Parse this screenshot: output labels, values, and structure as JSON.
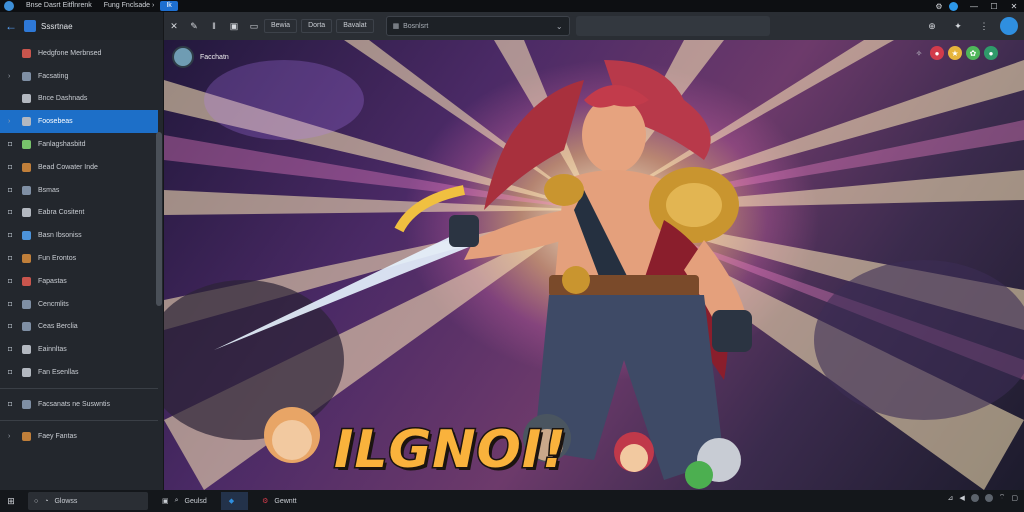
{
  "titlebar": {
    "tabs": [
      "Bnse Dasrt Eitflnrenk",
      "Fung Fnclsade ›",
      "Ik"
    ],
    "buttons": [
      "minimize-icon",
      "maximize-icon",
      "close-icon"
    ]
  },
  "sidebar": {
    "back_label": "←",
    "title": "Sssrtnae",
    "items": [
      {
        "label": "Hedgfone Merbnsed",
        "chevron": ""
      },
      {
        "label": "Facsating",
        "chevron": "›"
      },
      {
        "label": "Bnce Dashnads",
        "chevron": ""
      },
      {
        "label": "Foosebeas",
        "chevron": "›",
        "selected": true
      },
      {
        "label": "Fanlagshasbitd",
        "chevron": ""
      },
      {
        "label": "Bead Cowater Inde",
        "chevron": ""
      },
      {
        "label": "Bsmas",
        "chevron": ""
      },
      {
        "label": "Eabra Cositent",
        "chevron": ""
      },
      {
        "label": "Basn Ibsoniss",
        "chevron": ""
      },
      {
        "label": "Fun Erontos",
        "chevron": ""
      },
      {
        "label": "Fapastas",
        "chevron": ""
      },
      {
        "label": "Cencmlits",
        "chevron": ""
      },
      {
        "label": "Ceas Berclia",
        "chevron": ""
      },
      {
        "label": "Eainnltas",
        "chevron": ""
      },
      {
        "label": "Fan Esenllas",
        "chevron": ""
      },
      {
        "label": "Facsanats ne Suswntis",
        "chevron": ""
      },
      {
        "label": "Faey Fantas",
        "chevron": ""
      }
    ]
  },
  "toolbar": {
    "labels": [
      "Bewia",
      "Dorta",
      "Bavalat"
    ],
    "search_placeholder": "Bosnlsrt"
  },
  "banner": {
    "creator": "Facchatn",
    "logo": "ILGNOI!"
  },
  "taskbar": {
    "search": "Glowss",
    "items": [
      {
        "label": "Geulsd"
      },
      {
        "label": ""
      },
      {
        "label": "Gewntt"
      }
    ]
  },
  "colors": {
    "accent": "#1d6fc8",
    "sidebar_bg": "#23272d",
    "toolbar_bg": "#2a2e34",
    "logo": "#f9b23c"
  }
}
